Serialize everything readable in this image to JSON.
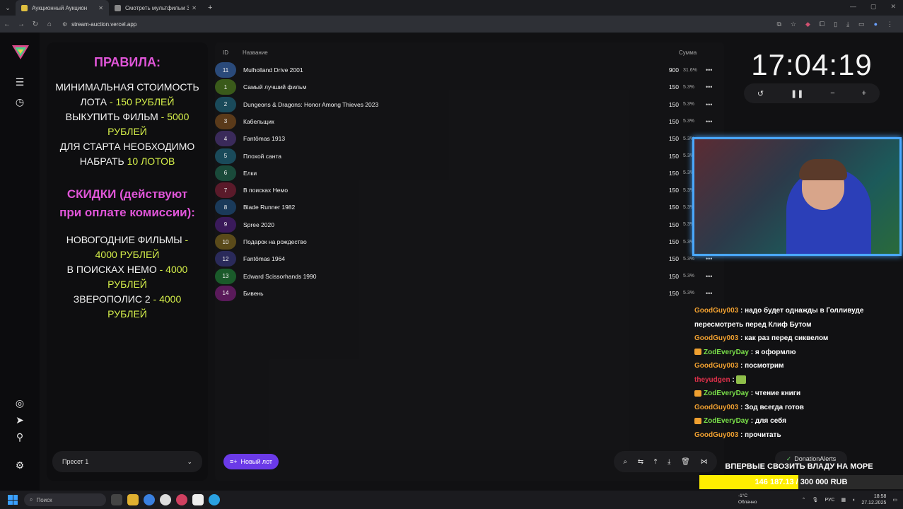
{
  "browser": {
    "tabs": [
      {
        "title": "Аукционный Аукцион",
        "active": true,
        "color": "#e0c040"
      },
      {
        "title": "Смотреть мультфильм Зверо...",
        "active": false,
        "color": "#888888"
      }
    ],
    "url": "stream-auction.vercel.app"
  },
  "rules": {
    "title": "ПРАВИЛА:",
    "lines": [
      {
        "text": "МИНИМАЛЬНАЯ СТОИМОСТЬ",
        "hl": ""
      },
      {
        "text": "ЛОТА ",
        "hl": "- 150 РУБЛЕЙ"
      },
      {
        "text": "ВЫКУПИТЬ ФИЛЬМ ",
        "hl": "- 5000"
      },
      {
        "text": "",
        "hl": "РУБЛЕЙ"
      },
      {
        "text": "ДЛЯ СТАРТА НЕОБХОДИМО",
        "hl": ""
      },
      {
        "text": "НАБРАТЬ ",
        "hl": "10 ЛОТОВ"
      }
    ],
    "discount_title": "СКИДКИ (действуют",
    "discount_title2": "при оплате комиссии):",
    "discounts": [
      {
        "text": "НОВОГОДНИЕ ФИЛЬМЫ ",
        "hl": "-"
      },
      {
        "text": "",
        "hl": "4000 РУБЛЕЙ"
      },
      {
        "text": "В ПОИСКАХ НЕМО ",
        "hl": "- 4000"
      },
      {
        "text": "",
        "hl": "РУБЛЕЙ"
      },
      {
        "text": "ЗВЕРОПОЛИС 2 ",
        "hl": "- 4000"
      },
      {
        "text": "",
        "hl": "РУБЛЕЙ"
      }
    ]
  },
  "preset": {
    "label": "Пресет 1"
  },
  "table": {
    "headers": {
      "id": "ID",
      "name": "Название",
      "sum": "Сумма"
    },
    "rows": [
      {
        "id": "11",
        "name": "Mulholland Drive 2001",
        "sum": "900",
        "pct": "31.6%",
        "color": "#2a4a7a"
      },
      {
        "id": "1",
        "name": "Самый лучший фильм",
        "sum": "150",
        "pct": "5.3%",
        "color": "#3a5a1a"
      },
      {
        "id": "2",
        "name": "Dungeons & Dragons: Honor Among Thieves 2023",
        "sum": "150",
        "pct": "5.3%",
        "color": "#1a4a5a"
      },
      {
        "id": "3",
        "name": "Кабельщик",
        "sum": "150",
        "pct": "5.3%",
        "color": "#5a3a1a"
      },
      {
        "id": "4",
        "name": "Fantômas 1913",
        "sum": "150",
        "pct": "5.3%",
        "color": "#3a2a5a"
      },
      {
        "id": "5",
        "name": "Плохой санта",
        "sum": "150",
        "pct": "5.3%",
        "color": "#1a4a5a"
      },
      {
        "id": "6",
        "name": "Елки",
        "sum": "150",
        "pct": "5.3%",
        "color": "#1a4a3a"
      },
      {
        "id": "7",
        "name": "В поисках Немо",
        "sum": "150",
        "pct": "5.3%",
        "color": "#5a1a2a"
      },
      {
        "id": "8",
        "name": "Blade Runner 1982",
        "sum": "150",
        "pct": "5.3%",
        "color": "#1a3a5a"
      },
      {
        "id": "9",
        "name": "Spree 2020",
        "sum": "150",
        "pct": "5.3%",
        "color": "#3a1a5a"
      },
      {
        "id": "10",
        "name": "Подарок на рождество",
        "sum": "150",
        "pct": "5.3%",
        "color": "#5a4a1a"
      },
      {
        "id": "12",
        "name": "Fantômas 1964",
        "sum": "150",
        "pct": "5.3%",
        "color": "#2a2a5a"
      },
      {
        "id": "13",
        "name": "Edward Scissorhands 1990",
        "sum": "150",
        "pct": "5.3%",
        "color": "#1a5a2a"
      },
      {
        "id": "14",
        "name": "Бивень",
        "sum": "150",
        "pct": "5.3%",
        "color": "#5a1a5a"
      }
    ]
  },
  "actions": {
    "new_lot": "Новый лот"
  },
  "timer": {
    "display": "17:04:19"
  },
  "chat": [
    {
      "user": "GoodGuy003",
      "cls": "u",
      "badge": false,
      "msg": "надо будет однажды в Голливуде пересмотреть перед Клиф Бутом"
    },
    {
      "user": "GoodGuy003",
      "cls": "u",
      "badge": false,
      "msg": "как раз перед сиквелом"
    },
    {
      "user": "ZodEveryDay",
      "cls": "u2",
      "badge": true,
      "msg": "я оформлю"
    },
    {
      "user": "GoodGuy003",
      "cls": "u",
      "badge": false,
      "msg": "посмотрим"
    },
    {
      "user": "theyudgen",
      "cls": "u3",
      "badge": false,
      "msg": ""
    },
    {
      "user": "ZodEveryDay",
      "cls": "u2",
      "badge": true,
      "msg": "чтение книги"
    },
    {
      "user": "GoodGuy003",
      "cls": "u",
      "badge": false,
      "msg": "Зод всегда готов"
    },
    {
      "user": "ZodEveryDay",
      "cls": "u2",
      "badge": true,
      "msg": "для себя"
    },
    {
      "user": "GoodGuy003",
      "cls": "u",
      "badge": false,
      "msg": "прочитать"
    }
  ],
  "donation": {
    "label": "DonationAlerts"
  },
  "goal": {
    "title": "ВПЕРВЫЕ СВОЗИТЬ ВЛАДУ НА МОРЕ",
    "current": "146 187.13",
    "target": "300 000 RUB",
    "progress": 0.487
  },
  "taskbar": {
    "search": "Поиск",
    "weather_temp": "-1°C",
    "weather_desc": "Облачно",
    "lang": "РУС",
    "time": "18:58",
    "date": "27.12.2025"
  }
}
